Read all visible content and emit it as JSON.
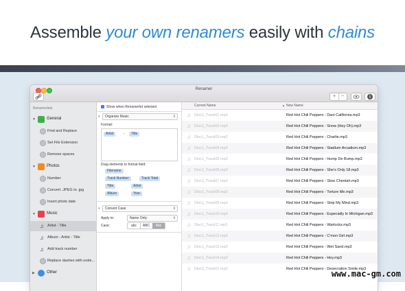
{
  "headline": {
    "part1": "Assemble ",
    "highlight1": "your own renamers",
    "part2": " easily with ",
    "highlight2": "chains"
  },
  "window": {
    "title": "Renamer",
    "toolbar": {
      "plus_label": "+",
      "minus_label": "−"
    }
  },
  "sidebar": {
    "heading": "Renamerlets",
    "categories": [
      {
        "label": "General",
        "icon": "cube-icon",
        "items": [
          "Find and Replace",
          "Set File Extension",
          "Remove spaces"
        ]
      },
      {
        "label": "Photos",
        "icon": "photo-icon",
        "items": [
          "Number",
          "Convert .JPEG to .jpg",
          "Insert photo date"
        ]
      },
      {
        "label": "Music",
        "icon": "music-icon",
        "items": [
          "Artist - Title",
          "Album - Artist - Title",
          "Add track number",
          "Replace dashes with unde..."
        ]
      },
      {
        "label": "Other",
        "icon": "gear-icon",
        "items": []
      }
    ],
    "selected": "Artist - Title"
  },
  "middle": {
    "show_selected_label": "Show when Renamerlet selected",
    "renamerlet1": "Organize Music",
    "format_label": "Format:",
    "format_tokens": [
      "Artist",
      "-",
      "Title"
    ],
    "drag_label": "Drag elements to format field:",
    "elements": [
      "Filename",
      "Track Number",
      "Track Total",
      "Title",
      "Artist",
      "Album",
      "Year"
    ],
    "renamerlet2": "Convert Case",
    "apply_to_label": "Apply to:",
    "apply_to_value": "Name Only",
    "case_label": "Case:",
    "case_options": [
      "abc",
      "ABC",
      "Abc"
    ]
  },
  "table": {
    "col_current": "Current Name",
    "col_new": "New Name",
    "rows": [
      {
        "current": "Disc1_Track01.mp3",
        "new": "Red Hot Chili Peppers - Dani California.mp3"
      },
      {
        "current": "Disc1_Track02.mp3",
        "new": "Red Hot Chili Peppers - Snow (Hey Oh).mp3"
      },
      {
        "current": "Disc1_Track03.mp3",
        "new": "Red Hot Chili Peppers - Charlie.mp3"
      },
      {
        "current": "Disc1_Track04.mp3",
        "new": "Red Hot Chili Peppers - Stadium Arcadium.mp3"
      },
      {
        "current": "Disc1_Track05.mp3",
        "new": "Red Hot Chili Peppers - Hump De Bump.mp3"
      },
      {
        "current": "Disc1_Track06.mp3",
        "new": "Red Hot Chili Peppers - She's Only 18.mp3"
      },
      {
        "current": "Disc1_Track07.mp3",
        "new": "Red Hot Chili Peppers - Slow Cheetah.mp3"
      },
      {
        "current": "Disc1_Track08.mp3",
        "new": "Red Hot Chili Peppers - Torture Me.mp3"
      },
      {
        "current": "Disc1_Track09.mp3",
        "new": "Red Hot Chili Peppers - Strip My Mind.mp3"
      },
      {
        "current": "Disc1_Track10.mp3",
        "new": "Red Hot Chili Peppers - Especially In Michigan.mp3"
      },
      {
        "current": "Disc1_Track11.mp3",
        "new": "Red Hot Chili Peppers - Warlocks.mp3"
      },
      {
        "current": "Disc1_Track12.mp3",
        "new": "Red Hot Chili Peppers - C'mon Girl.mp3"
      },
      {
        "current": "Disc1_Track13.mp3",
        "new": "Red Hot Chili Peppers - Wet Sand.mp3"
      },
      {
        "current": "Disc1_Track14.mp3",
        "new": "Red Hot Chili Peppers - Hey.mp3"
      },
      {
        "current": "Disc2_Track01.mp3",
        "new": "Red Hot Chili Peppers - Desecration Smile.mp3"
      }
    ]
  },
  "watermark": "www.mac-gm.com",
  "colors": {
    "accent": "#2d8bd6",
    "headline_text": "#2c3440",
    "selection": "#d1d3d6"
  }
}
